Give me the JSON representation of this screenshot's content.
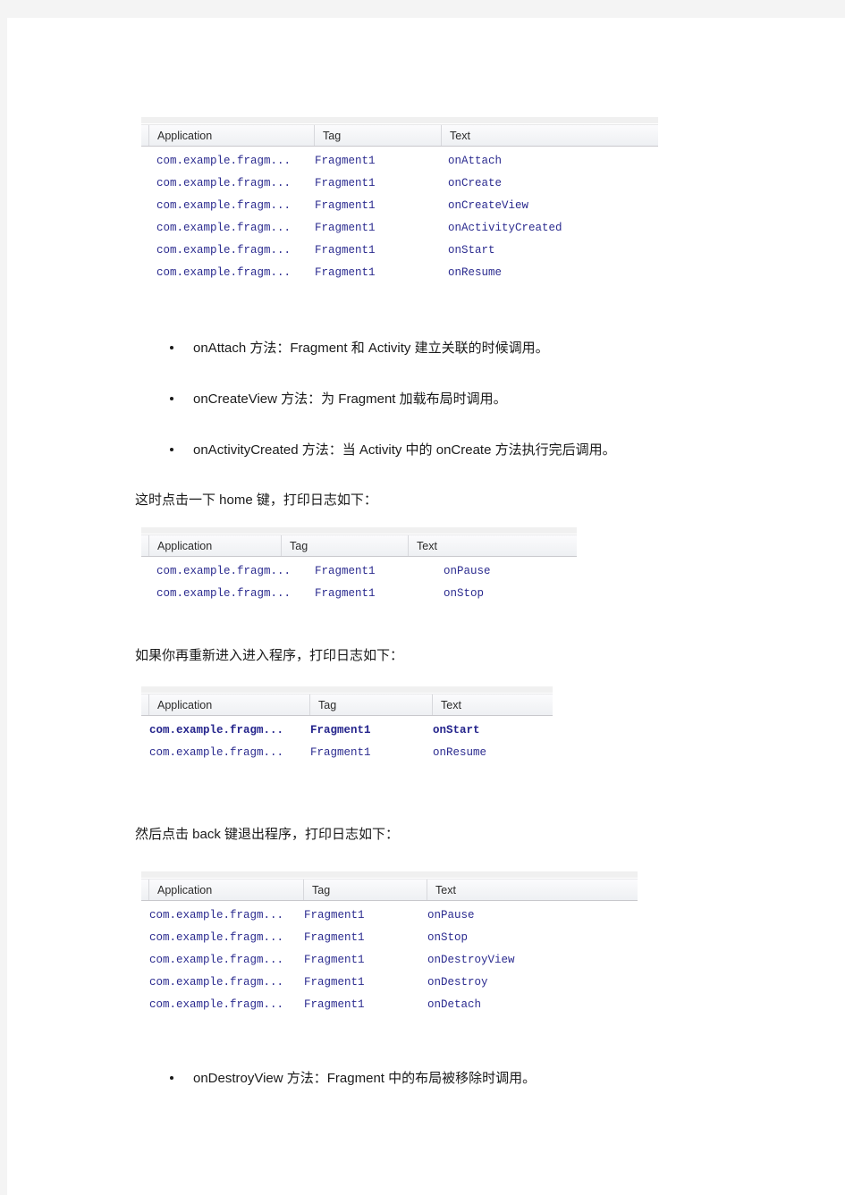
{
  "document": {
    "language": "zh-CN",
    "topic": "Android Fragment lifecycle log output"
  },
  "logcat_columns": [
    "Application",
    "Tag",
    "Text"
  ],
  "tables": [
    {
      "name": "logcat-table-initial-launch",
      "columns": [
        "Application",
        "Tag",
        "Text"
      ],
      "rows": [
        {
          "application": "com.example.fragm...",
          "tag": "Fragment1",
          "text": "onAttach"
        },
        {
          "application": "com.example.fragm...",
          "tag": "Fragment1",
          "text": "onCreate"
        },
        {
          "application": "com.example.fragm...",
          "tag": "Fragment1",
          "text": "onCreateView"
        },
        {
          "application": "com.example.fragm...",
          "tag": "Fragment1",
          "text": "onActivityCreated"
        },
        {
          "application": "com.example.fragm...",
          "tag": "Fragment1",
          "text": "onStart"
        },
        {
          "application": "com.example.fragm...",
          "tag": "Fragment1",
          "text": "onResume"
        }
      ]
    },
    {
      "name": "logcat-table-home-pressed",
      "columns": [
        "Application",
        "Tag",
        "Text"
      ],
      "rows": [
        {
          "application": "com.example.fragm...",
          "tag": "Fragment1",
          "text": "onPause"
        },
        {
          "application": "com.example.fragm...",
          "tag": "Fragment1",
          "text": "onStop"
        }
      ]
    },
    {
      "name": "logcat-table-reenter",
      "columns": [
        "Application",
        "Tag",
        "Text"
      ],
      "rows": [
        {
          "application": "com.example.fragm...",
          "tag": "Fragment1",
          "text": "onStart"
        },
        {
          "application": "com.example.fragm...",
          "tag": "Fragment1",
          "text": "onResume"
        }
      ]
    },
    {
      "name": "logcat-table-back-pressed",
      "columns": [
        "Application",
        "Tag",
        "Text"
      ],
      "rows": [
        {
          "application": "com.example.fragm...",
          "tag": "Fragment1",
          "text": "onPause"
        },
        {
          "application": "com.example.fragm...",
          "tag": "Fragment1",
          "text": "onStop"
        },
        {
          "application": "com.example.fragm...",
          "tag": "Fragment1",
          "text": "onDestroyView"
        },
        {
          "application": "com.example.fragm...",
          "tag": "Fragment1",
          "text": "onDestroy"
        },
        {
          "application": "com.example.fragm...",
          "tag": "Fragment1",
          "text": "onDetach"
        }
      ]
    }
  ],
  "bullets_first": [
    "onAttach 方法：Fragment 和 Activity 建立关联的时候调用。",
    "onCreateView 方法：为 Fragment 加载布局时调用。",
    "onActivityCreated 方法：当 Activity 中的 onCreate 方法执行完后调用。"
  ],
  "paragraphs": {
    "home_key": "这时点击一下 home 键，打印日志如下：",
    "reenter": "如果你再重新进入进入程序，打印日志如下：",
    "back_key": "然后点击 back 键退出程序，打印日志如下："
  },
  "bullets_last": [
    "onDestroyView 方法：Fragment 中的布局被移除时调用。"
  ],
  "colors": {
    "page_background": "#ffffff",
    "canvas_background": "#f4f4f4",
    "log_text": "#2b2b8f",
    "header_text": "#2b2b2b",
    "body_text": "#1a1a1a"
  }
}
